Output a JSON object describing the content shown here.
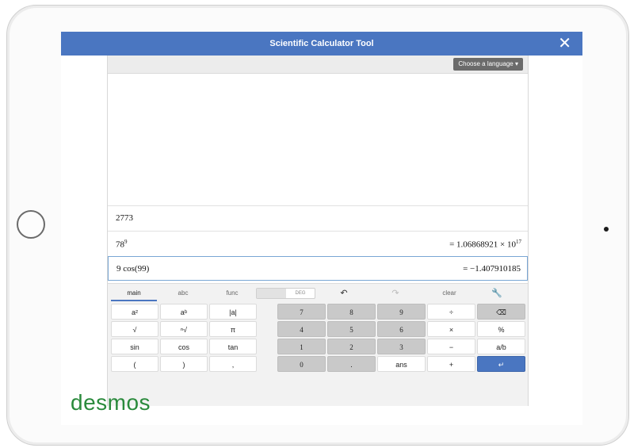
{
  "window": {
    "title": "Scientific Calculator Tool",
    "close": "✕"
  },
  "toolbar": {
    "language_label": "Choose a language ▾"
  },
  "expressions": [
    {
      "input": "2773",
      "result": ""
    },
    {
      "input_base": "78",
      "input_exp": "9",
      "result_prefix": "= 1.06868921 × 10",
      "result_exp": "17"
    },
    {
      "input": "9 cos(99)",
      "result": "= −1.407910185"
    }
  ],
  "keypad": {
    "tabs": [
      "main",
      "abc",
      "func"
    ],
    "angle_mode": "DEG",
    "undo": "↶",
    "redo": "↷",
    "clear": "clear",
    "settings": "🔧",
    "keys": [
      [
        "a²",
        "aᵇ",
        "|a|",
        "7",
        "8",
        "9",
        "÷",
        "⌫"
      ],
      [
        "√",
        "ⁿ√",
        "π",
        "4",
        "5",
        "6",
        "×",
        "%"
      ],
      [
        "sin",
        "cos",
        "tan",
        "1",
        "2",
        "3",
        "−",
        "a/b"
      ],
      [
        "(",
        ")",
        ",",
        "0",
        ".",
        "ans",
        "+",
        "↵"
      ]
    ]
  },
  "brand": {
    "logo": "desmos"
  }
}
